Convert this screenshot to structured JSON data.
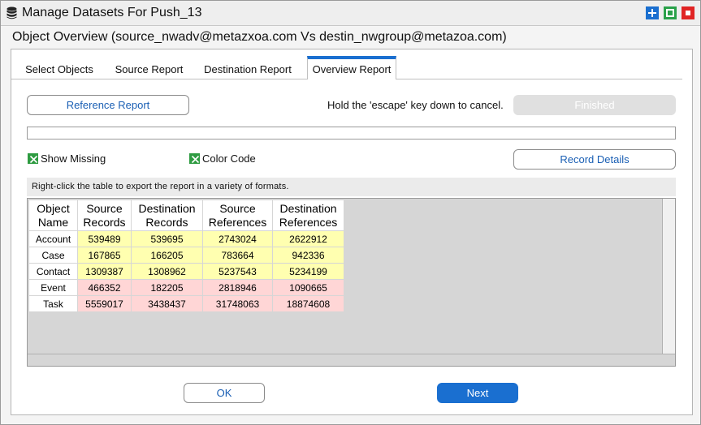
{
  "window": {
    "title": "Manage Datasets For Push_13",
    "icons": [
      "database-icon",
      "add-icon",
      "maximize-icon",
      "close-icon"
    ],
    "colors": {
      "accent": "#1a6fd0",
      "add": "#1a6fd0",
      "maximize": "#2aa14a",
      "close": "#e02424"
    }
  },
  "header": "Object Overview (source_nwadv@metazxoa.com Vs destin_nwgroup@metazoa.com)",
  "tabs": [
    {
      "label": "Select Objects",
      "active": false
    },
    {
      "label": "Source Report",
      "active": false
    },
    {
      "label": "Destination Report",
      "active": false
    },
    {
      "label": "Overview Report",
      "active": true
    }
  ],
  "controls": {
    "reference_report": "Reference Report",
    "escape_hint": "Hold the 'escape' key down to cancel.",
    "finished": "Finished",
    "progress": 0,
    "show_missing": {
      "label": "Show Missing",
      "checked": true
    },
    "color_code": {
      "label": "Color Code",
      "checked": true
    },
    "record_details": "Record Details"
  },
  "hint": "Right-click the table to export the report in a variety of formats.",
  "table": {
    "headers": [
      [
        "Object",
        "Name"
      ],
      [
        "Source",
        "Records"
      ],
      [
        "Destination",
        "Records"
      ],
      [
        "Source",
        "References"
      ],
      [
        "Destination",
        "References"
      ]
    ],
    "rows": [
      {
        "name": "Account",
        "values": [
          "539489",
          "539695",
          "2743024",
          "2622912"
        ],
        "status": "yellow"
      },
      {
        "name": "Case",
        "values": [
          "167865",
          "166205",
          "783664",
          "942336"
        ],
        "status": "yellow"
      },
      {
        "name": "Contact",
        "values": [
          "1309387",
          "1308962",
          "5237543",
          "5234199"
        ],
        "status": "yellow"
      },
      {
        "name": "Event",
        "values": [
          "466352",
          "182205",
          "2818946",
          "1090665"
        ],
        "status": "red"
      },
      {
        "name": "Task",
        "values": [
          "5559017",
          "3438437",
          "31748063",
          "18874608"
        ],
        "status": "red"
      }
    ],
    "colors": {
      "yellow": "#ffffb0",
      "red": "#ffd6d6"
    }
  },
  "footer": {
    "ok": "OK",
    "next": "Next"
  }
}
